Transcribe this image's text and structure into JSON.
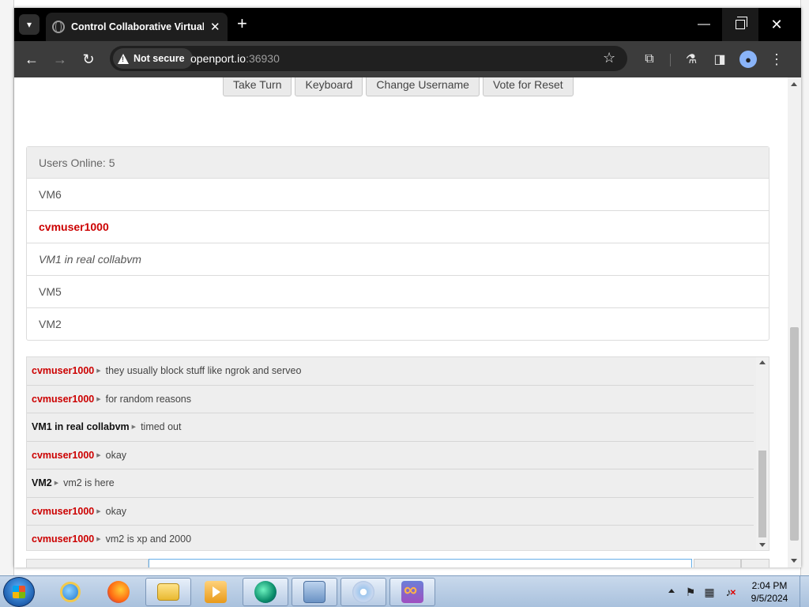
{
  "browser": {
    "tab_title": "Control Collaborative Virtual M",
    "security_label": "Not secure",
    "url_host": "openport.io",
    "url_port": ":36930"
  },
  "vm_buttons": [
    "Take Turn",
    "Keyboard",
    "Change Username",
    "Vote for Reset"
  ],
  "users": {
    "header": "Users Online: 5",
    "list": [
      {
        "name": "VM6",
        "style": "normal"
      },
      {
        "name": "cvmuser1000",
        "style": "self"
      },
      {
        "name": "VM1 in real collabvm",
        "style": "italic"
      },
      {
        "name": "VM5",
        "style": "normal"
      },
      {
        "name": "VM2",
        "style": "normal"
      }
    ]
  },
  "chat": {
    "messages": [
      {
        "user": "cvmuser1000",
        "user_color": "red",
        "text": "they usually block stuff like ngrok and serveo"
      },
      {
        "user": "cvmuser1000",
        "user_color": "red",
        "text": "for random reasons"
      },
      {
        "user": "VM1 in real collabvm",
        "user_color": "black",
        "text": "timed out"
      },
      {
        "user": "cvmuser1000",
        "user_color": "red",
        "text": "okay"
      },
      {
        "user": "VM2",
        "user_color": "black",
        "text": "vm2 is here"
      },
      {
        "user": "cvmuser1000",
        "user_color": "red",
        "text": "okay"
      },
      {
        "user": "cvmuser1000",
        "user_color": "red",
        "text": "vm2 is xp and 2000"
      }
    ]
  },
  "taskbar": {
    "time": "2:04 PM",
    "date": "9/5/2024",
    "apps": [
      "internet-explorer",
      "firefox",
      "file-explorer",
      "media-player",
      "collabvm",
      "remote-desktop",
      "disc-burner",
      "infinity-app"
    ]
  },
  "colors": {
    "self_user": "#cc0000",
    "titlebar": "#000000",
    "toolbar": "#3c3c3c"
  }
}
